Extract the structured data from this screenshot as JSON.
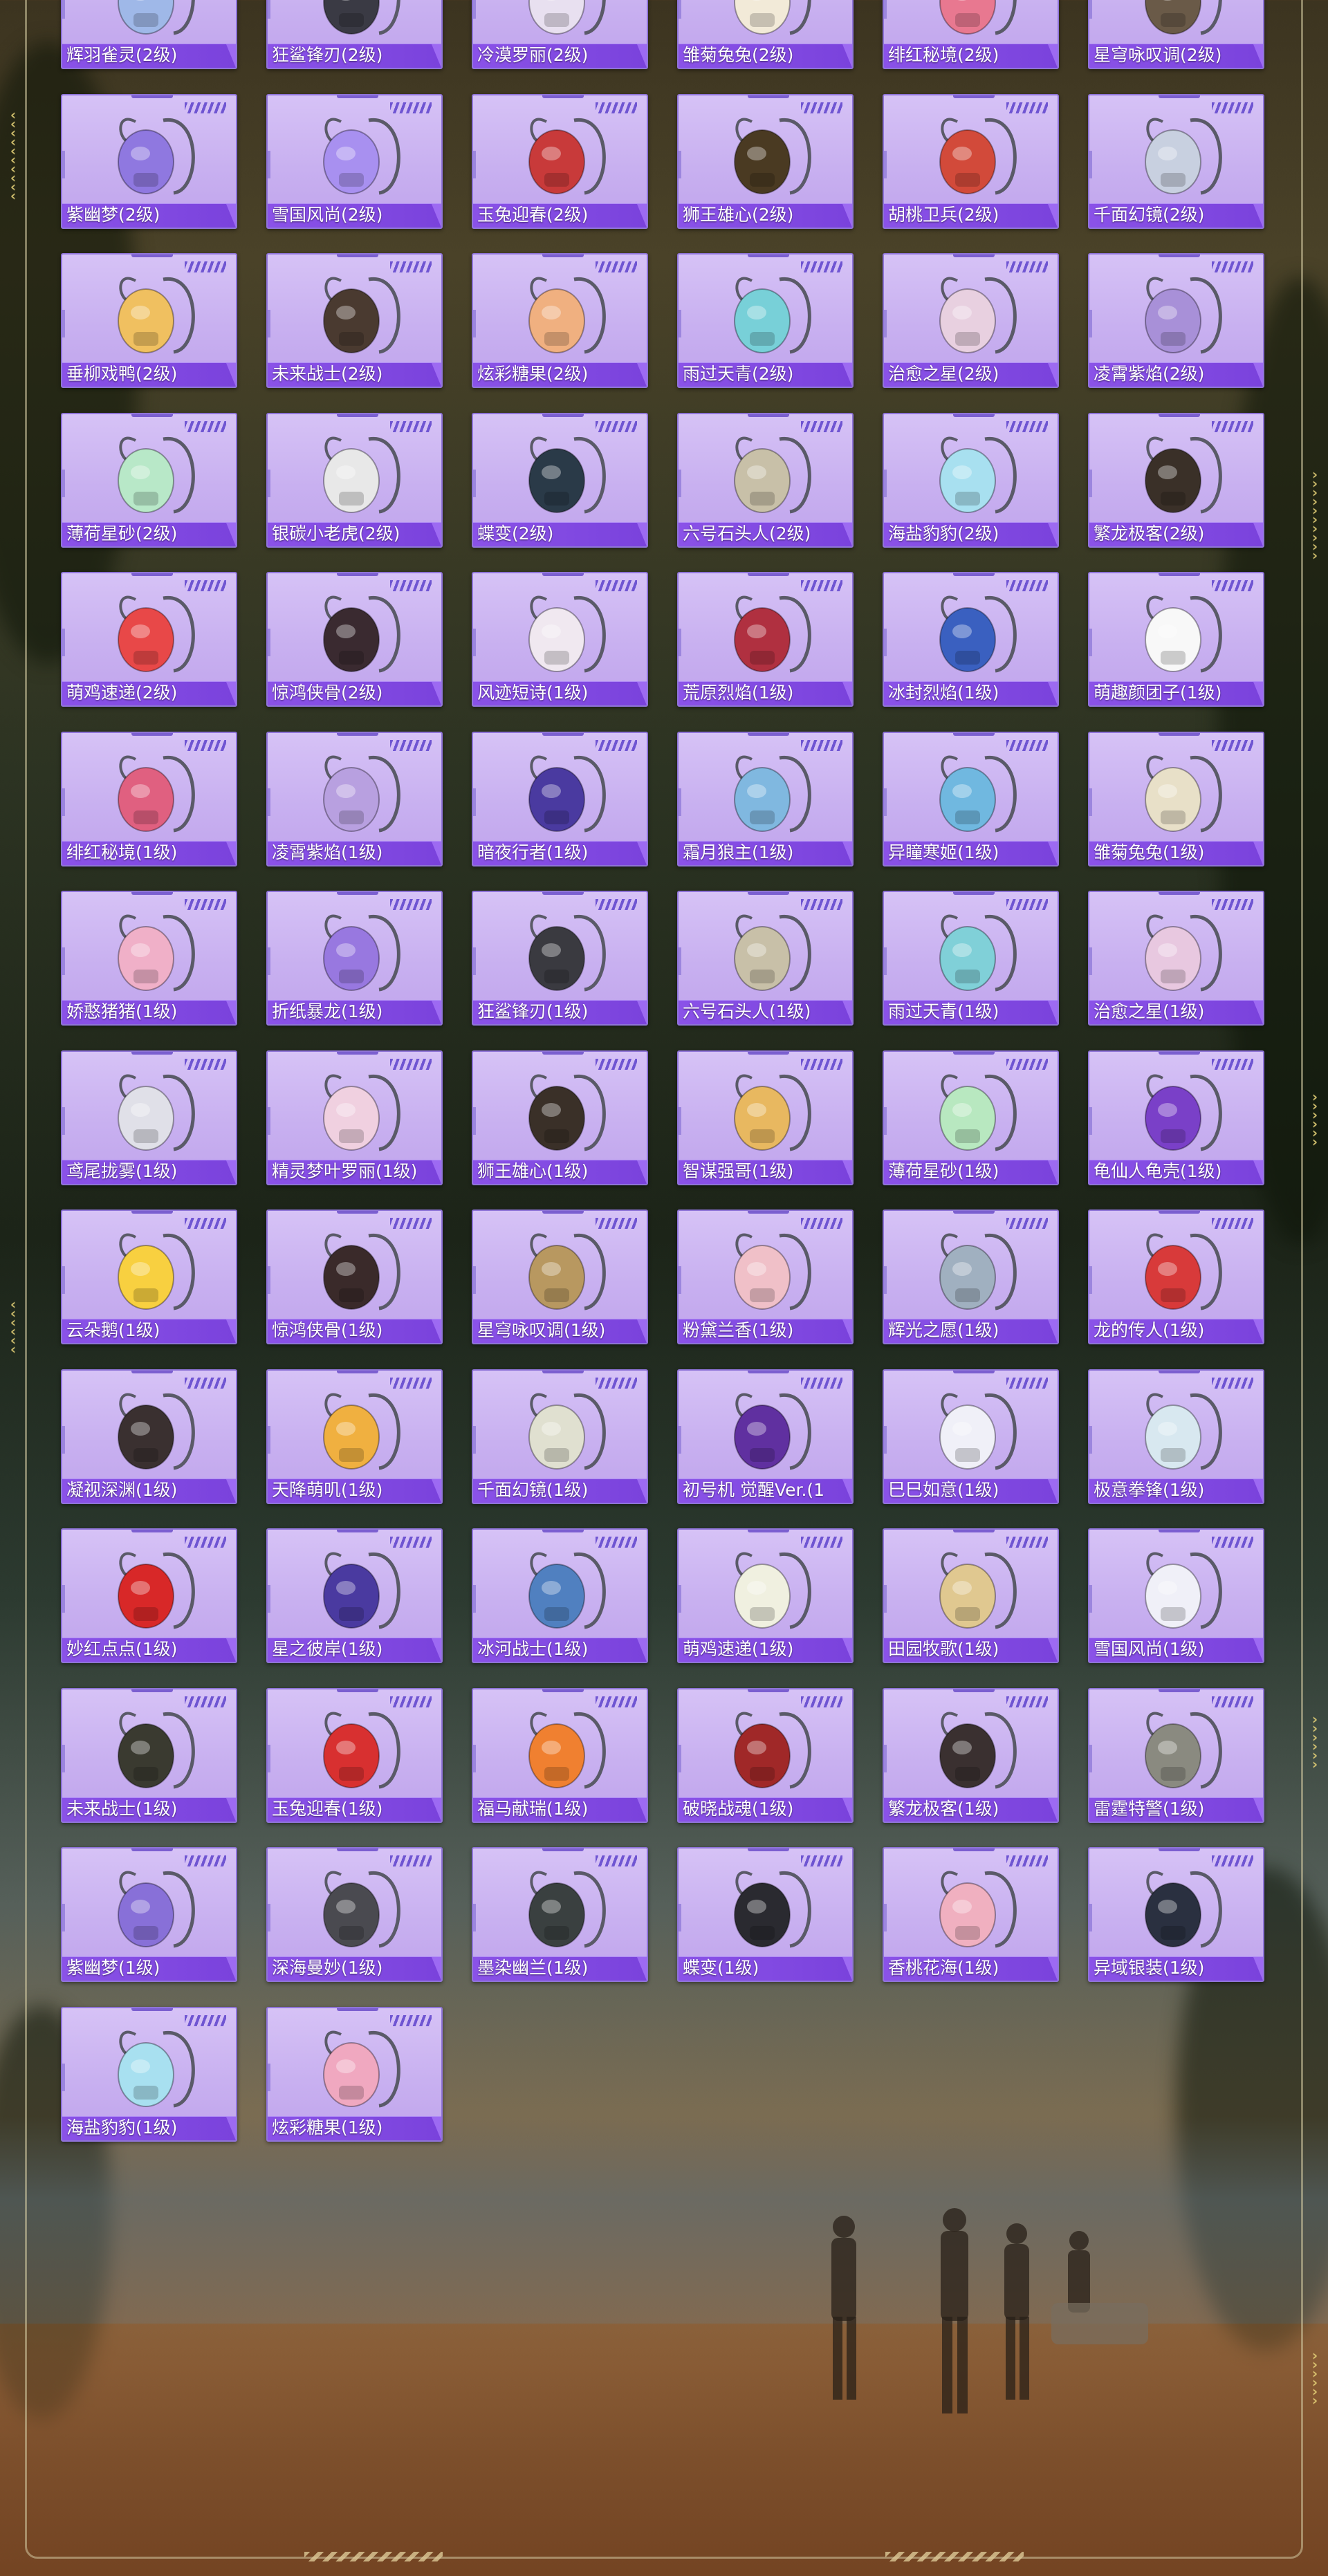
{
  "page": {
    "frame_accent": "#d2c8a0",
    "card_color": "#c8b0f0",
    "label_color": "#8a52e8"
  },
  "items": [
    {
      "name": "辉羽雀灵(2级)",
      "icon": "backpack-icon",
      "color": "#9fb8e8"
    },
    {
      "name": "狂鲨锋刃(2级)",
      "icon": "backpack-icon",
      "color": "#3a3a44"
    },
    {
      "name": "冷漠罗丽(2级)",
      "icon": "backpack-icon",
      "color": "#e8e0f0"
    },
    {
      "name": "雏菊兔兔(2级)",
      "icon": "backpack-icon",
      "color": "#f2ead8"
    },
    {
      "name": "绯红秘境(2级)",
      "icon": "backpack-icon",
      "color": "#e87890"
    },
    {
      "name": "星穹咏叹调(2级)",
      "icon": "backpack-icon",
      "color": "#6a5a48"
    },
    {
      "name": "紫幽梦(2级)",
      "icon": "backpack-icon",
      "color": "#8f78e0"
    },
    {
      "name": "雪国风尚(2级)",
      "icon": "backpack-icon",
      "color": "#a890f0"
    },
    {
      "name": "玉兔迎春(2级)",
      "icon": "backpack-icon",
      "color": "#c83a3a"
    },
    {
      "name": "狮王雄心(2级)",
      "icon": "backpack-icon",
      "color": "#4a3a22"
    },
    {
      "name": "胡桃卫兵(2级)",
      "icon": "backpack-icon",
      "color": "#d24a3a"
    },
    {
      "name": "千面幻镜(2级)",
      "icon": "backpack-icon",
      "color": "#c8d0e0"
    },
    {
      "name": "垂柳戏鸭(2级)",
      "icon": "backpack-icon",
      "color": "#f0c060"
    },
    {
      "name": "未来战士(2级)",
      "icon": "backpack-icon",
      "color": "#4a3a30"
    },
    {
      "name": "炫彩糖果(2级)",
      "icon": "backpack-icon",
      "color": "#f0b080"
    },
    {
      "name": "雨过天青(2级)",
      "icon": "backpack-icon",
      "color": "#78d0d8"
    },
    {
      "name": "治愈之星(2级)",
      "icon": "backpack-icon",
      "color": "#e8d0e0"
    },
    {
      "name": "凌霄紫焰(2级)",
      "icon": "backpack-icon",
      "color": "#a890d8"
    },
    {
      "name": "薄荷星砂(2级)",
      "icon": "backpack-icon",
      "color": "#b8e8c8"
    },
    {
      "name": "银碳小老虎(2级)",
      "icon": "backpack-icon",
      "color": "#e8e8e8"
    },
    {
      "name": "蝶变(2级)",
      "icon": "backpack-icon",
      "color": "#2a3a48"
    },
    {
      "name": "六号石头人(2级)",
      "icon": "backpack-icon",
      "color": "#c8c0a8"
    },
    {
      "name": "海盐豹豹(2级)",
      "icon": "backpack-icon",
      "color": "#a8e0f0"
    },
    {
      "name": "繁龙极客(2级)",
      "icon": "backpack-icon",
      "color": "#3a3028"
    },
    {
      "name": "萌鸡速递(2级)",
      "icon": "backpack-icon",
      "color": "#e84848"
    },
    {
      "name": "惊鸿侠骨(2级)",
      "icon": "backpack-icon",
      "color": "#3a2a30"
    },
    {
      "name": "风迹短诗(1级)",
      "icon": "backpack-icon",
      "color": "#f0e8f0"
    },
    {
      "name": "荒原烈焰(1级)",
      "icon": "backpack-icon",
      "color": "#b03040"
    },
    {
      "name": "冰封烈焰(1级)",
      "icon": "backpack-icon",
      "color": "#3a60c0"
    },
    {
      "name": "萌趣颜团子(1级)",
      "icon": "backpack-icon",
      "color": "#f8f8f8"
    },
    {
      "name": "绯红秘境(1级)",
      "icon": "backpack-icon",
      "color": "#e06080"
    },
    {
      "name": "凌霄紫焰(1级)",
      "icon": "backpack-icon",
      "color": "#b8a0e0"
    },
    {
      "name": "暗夜行者(1级)",
      "icon": "backpack-icon",
      "color": "#4a3aa0"
    },
    {
      "name": "霜月狼主(1级)",
      "icon": "backpack-icon",
      "color": "#80b8e0"
    },
    {
      "name": "异瞳寒姬(1级)",
      "icon": "backpack-icon",
      "color": "#70b8e0"
    },
    {
      "name": "雏菊兔兔(1级)",
      "icon": "backpack-icon",
      "color": "#e8e0c8"
    },
    {
      "name": "娇憨猪猪(1级)",
      "icon": "backpack-icon",
      "color": "#f0b0c8"
    },
    {
      "name": "折纸暴龙(1级)",
      "icon": "backpack-icon",
      "color": "#9878e0"
    },
    {
      "name": "狂鲨锋刃(1级)",
      "icon": "backpack-icon",
      "color": "#3a3a40"
    },
    {
      "name": "六号石头人(1级)",
      "icon": "backpack-icon",
      "color": "#c8c0a8"
    },
    {
      "name": "雨过天青(1级)",
      "icon": "backpack-icon",
      "color": "#80d0d8"
    },
    {
      "name": "治愈之星(1级)",
      "icon": "backpack-icon",
      "color": "#e8c8e0"
    },
    {
      "name": "鸢尾拢雾(1级)",
      "icon": "backpack-icon",
      "color": "#e0e0e8"
    },
    {
      "name": "精灵梦叶罗丽(1级)",
      "icon": "backpack-icon",
      "color": "#f0d0e0"
    },
    {
      "name": "狮王雄心(1级)",
      "icon": "backpack-icon",
      "color": "#3a3028"
    },
    {
      "name": "智谋强哥(1级)",
      "icon": "backpack-icon",
      "color": "#e8b860"
    },
    {
      "name": "薄荷星砂(1级)",
      "icon": "backpack-icon",
      "color": "#b8e8c0"
    },
    {
      "name": "龟仙人龟壳(1级)",
      "icon": "backpack-icon",
      "color": "#7a40c8"
    },
    {
      "name": "云朵鹅(1级)",
      "icon": "backpack-icon",
      "color": "#f8d040"
    },
    {
      "name": "惊鸿侠骨(1级)",
      "icon": "backpack-icon",
      "color": "#3a2a2a"
    },
    {
      "name": "星穹咏叹调(1级)",
      "icon": "backpack-icon",
      "color": "#b89860"
    },
    {
      "name": "粉黛兰香(1级)",
      "icon": "backpack-icon",
      "color": "#f0c0c8"
    },
    {
      "name": "辉光之愿(1级)",
      "icon": "backpack-icon",
      "color": "#a0b0c0"
    },
    {
      "name": "龙的传人(1级)",
      "icon": "backpack-icon",
      "color": "#d83a3a"
    },
    {
      "name": "凝视深渊(1级)",
      "icon": "backpack-icon",
      "color": "#3a3030"
    },
    {
      "name": "天降萌叽(1级)",
      "icon": "backpack-icon",
      "color": "#f0b040"
    },
    {
      "name": "千面幻镜(1级)",
      "icon": "backpack-icon",
      "color": "#e0e0d0"
    },
    {
      "name": "初号机 觉醒Ver.(1",
      "icon": "backpack-icon",
      "color": "#6030a0"
    },
    {
      "name": "巳巳如意(1级)",
      "icon": "backpack-icon",
      "color": "#f0f0f8"
    },
    {
      "name": "极意拳锋(1级)",
      "icon": "backpack-icon",
      "color": "#d8e8f0"
    },
    {
      "name": "妙红点点(1级)",
      "icon": "backpack-icon",
      "color": "#d82828"
    },
    {
      "name": "星之彼岸(1级)",
      "icon": "backpack-icon",
      "color": "#4a3aa0"
    },
    {
      "name": "冰河战士(1级)",
      "icon": "backpack-icon",
      "color": "#5080c0"
    },
    {
      "name": "萌鸡速递(1级)",
      "icon": "backpack-icon",
      "color": "#f0f0e0"
    },
    {
      "name": "田园牧歌(1级)",
      "icon": "backpack-icon",
      "color": "#e0c890"
    },
    {
      "name": "雪国风尚(1级)",
      "icon": "backpack-icon",
      "color": "#f0f0f8"
    },
    {
      "name": "未来战士(1级)",
      "icon": "backpack-icon",
      "color": "#3a3a30"
    },
    {
      "name": "玉兔迎春(1级)",
      "icon": "backpack-icon",
      "color": "#d83030"
    },
    {
      "name": "福马献瑞(1级)",
      "icon": "backpack-icon",
      "color": "#f08030"
    },
    {
      "name": "破晓战魂(1级)",
      "icon": "backpack-icon",
      "color": "#a02828"
    },
    {
      "name": "繁龙极客(1级)",
      "icon": "backpack-icon",
      "color": "#3a3030"
    },
    {
      "name": "雷霆特警(1级)",
      "icon": "backpack-icon",
      "color": "#8a8a80"
    },
    {
      "name": "紫幽梦(1级)",
      "icon": "backpack-icon",
      "color": "#8870d8"
    },
    {
      "name": "深海曼妙(1级)",
      "icon": "backpack-icon",
      "color": "#4a4a50"
    },
    {
      "name": "墨染幽兰(1级)",
      "icon": "backpack-icon",
      "color": "#3a4040"
    },
    {
      "name": "蝶变(1级)",
      "icon": "backpack-icon",
      "color": "#2a2a30"
    },
    {
      "name": "香桃花海(1级)",
      "icon": "backpack-icon",
      "color": "#f0b0c0"
    },
    {
      "name": "异域银装(1级)",
      "icon": "backpack-icon",
      "color": "#2a3040"
    },
    {
      "name": "海盐豹豹(1级)",
      "icon": "backpack-icon",
      "color": "#a8e0f0"
    },
    {
      "name": "炫彩糖果(1级)",
      "icon": "backpack-icon",
      "color": "#f0a8c0"
    }
  ]
}
